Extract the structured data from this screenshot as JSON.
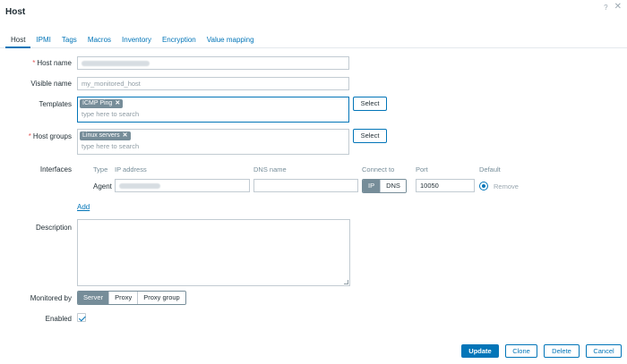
{
  "window": {
    "title": "Host"
  },
  "tabs": [
    "Host",
    "IPMI",
    "Tags",
    "Macros",
    "Inventory",
    "Encryption",
    "Value mapping"
  ],
  "form": {
    "host_name": {
      "label": "Host name",
      "value": "my_monitored_host"
    },
    "visible_name": {
      "label": "Visible name",
      "placeholder": "my_monitored_host"
    },
    "templates": {
      "label": "Templates",
      "chip": "ICMP Ping",
      "placeholder": "type here to search",
      "select_label": "Select"
    },
    "host_groups": {
      "label": "Host groups",
      "chip": "Linux servers",
      "placeholder": "type here to search",
      "select_label": "Select"
    },
    "interfaces": {
      "label": "Interfaces",
      "headers": {
        "type": "Type",
        "ip": "IP address",
        "dns": "DNS name",
        "connect": "Connect to",
        "port": "Port",
        "default": "Default"
      },
      "row": {
        "type": "Agent",
        "ip": "192.168.10.45",
        "dns": "",
        "connect_options": [
          "IP",
          "DNS"
        ],
        "connect_selected": "IP",
        "port": "10050",
        "remove_label": "Remove"
      },
      "add_label": "Add"
    },
    "description": {
      "label": "Description",
      "value": ""
    },
    "monitored_by": {
      "label": "Monitored by",
      "options": [
        "Server",
        "Proxy",
        "Proxy group"
      ],
      "selected": "Server"
    },
    "enabled": {
      "label": "Enabled",
      "checked": true
    }
  },
  "footer": {
    "update": "Update",
    "clone": "Clone",
    "delete": "Delete",
    "cancel": "Cancel"
  },
  "colors": {
    "accent": "#0275b8",
    "required": "#e45959",
    "chip": "#768d99"
  },
  "icons": {
    "help": "help-icon",
    "close": "close-icon"
  }
}
